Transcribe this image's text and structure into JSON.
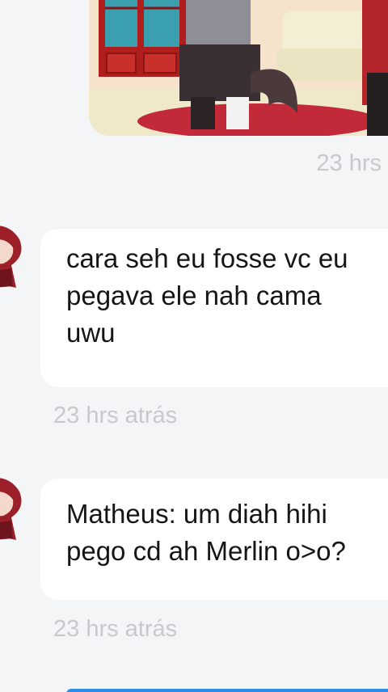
{
  "messages": [
    {
      "type": "image",
      "side": "right",
      "timestamp": "23 hrs"
    },
    {
      "type": "text",
      "side": "left",
      "text": "cara seh eu fosse vc eu\npegava ele nah cama\nuwu",
      "timestamp": "23 hrs atrás"
    },
    {
      "type": "text",
      "side": "left",
      "text": "Matheus: um diah hihi\npego cd ah Merlin o>o?",
      "timestamp": "23 hrs atrás"
    }
  ],
  "colors": {
    "background": "#f4f5f7",
    "bubble": "#ffffff",
    "timestamp": "#c8c9cc",
    "text": "#151515",
    "accent": "#2f8fe8"
  },
  "icons": {
    "avatar": "avatar-character-red-hair"
  }
}
